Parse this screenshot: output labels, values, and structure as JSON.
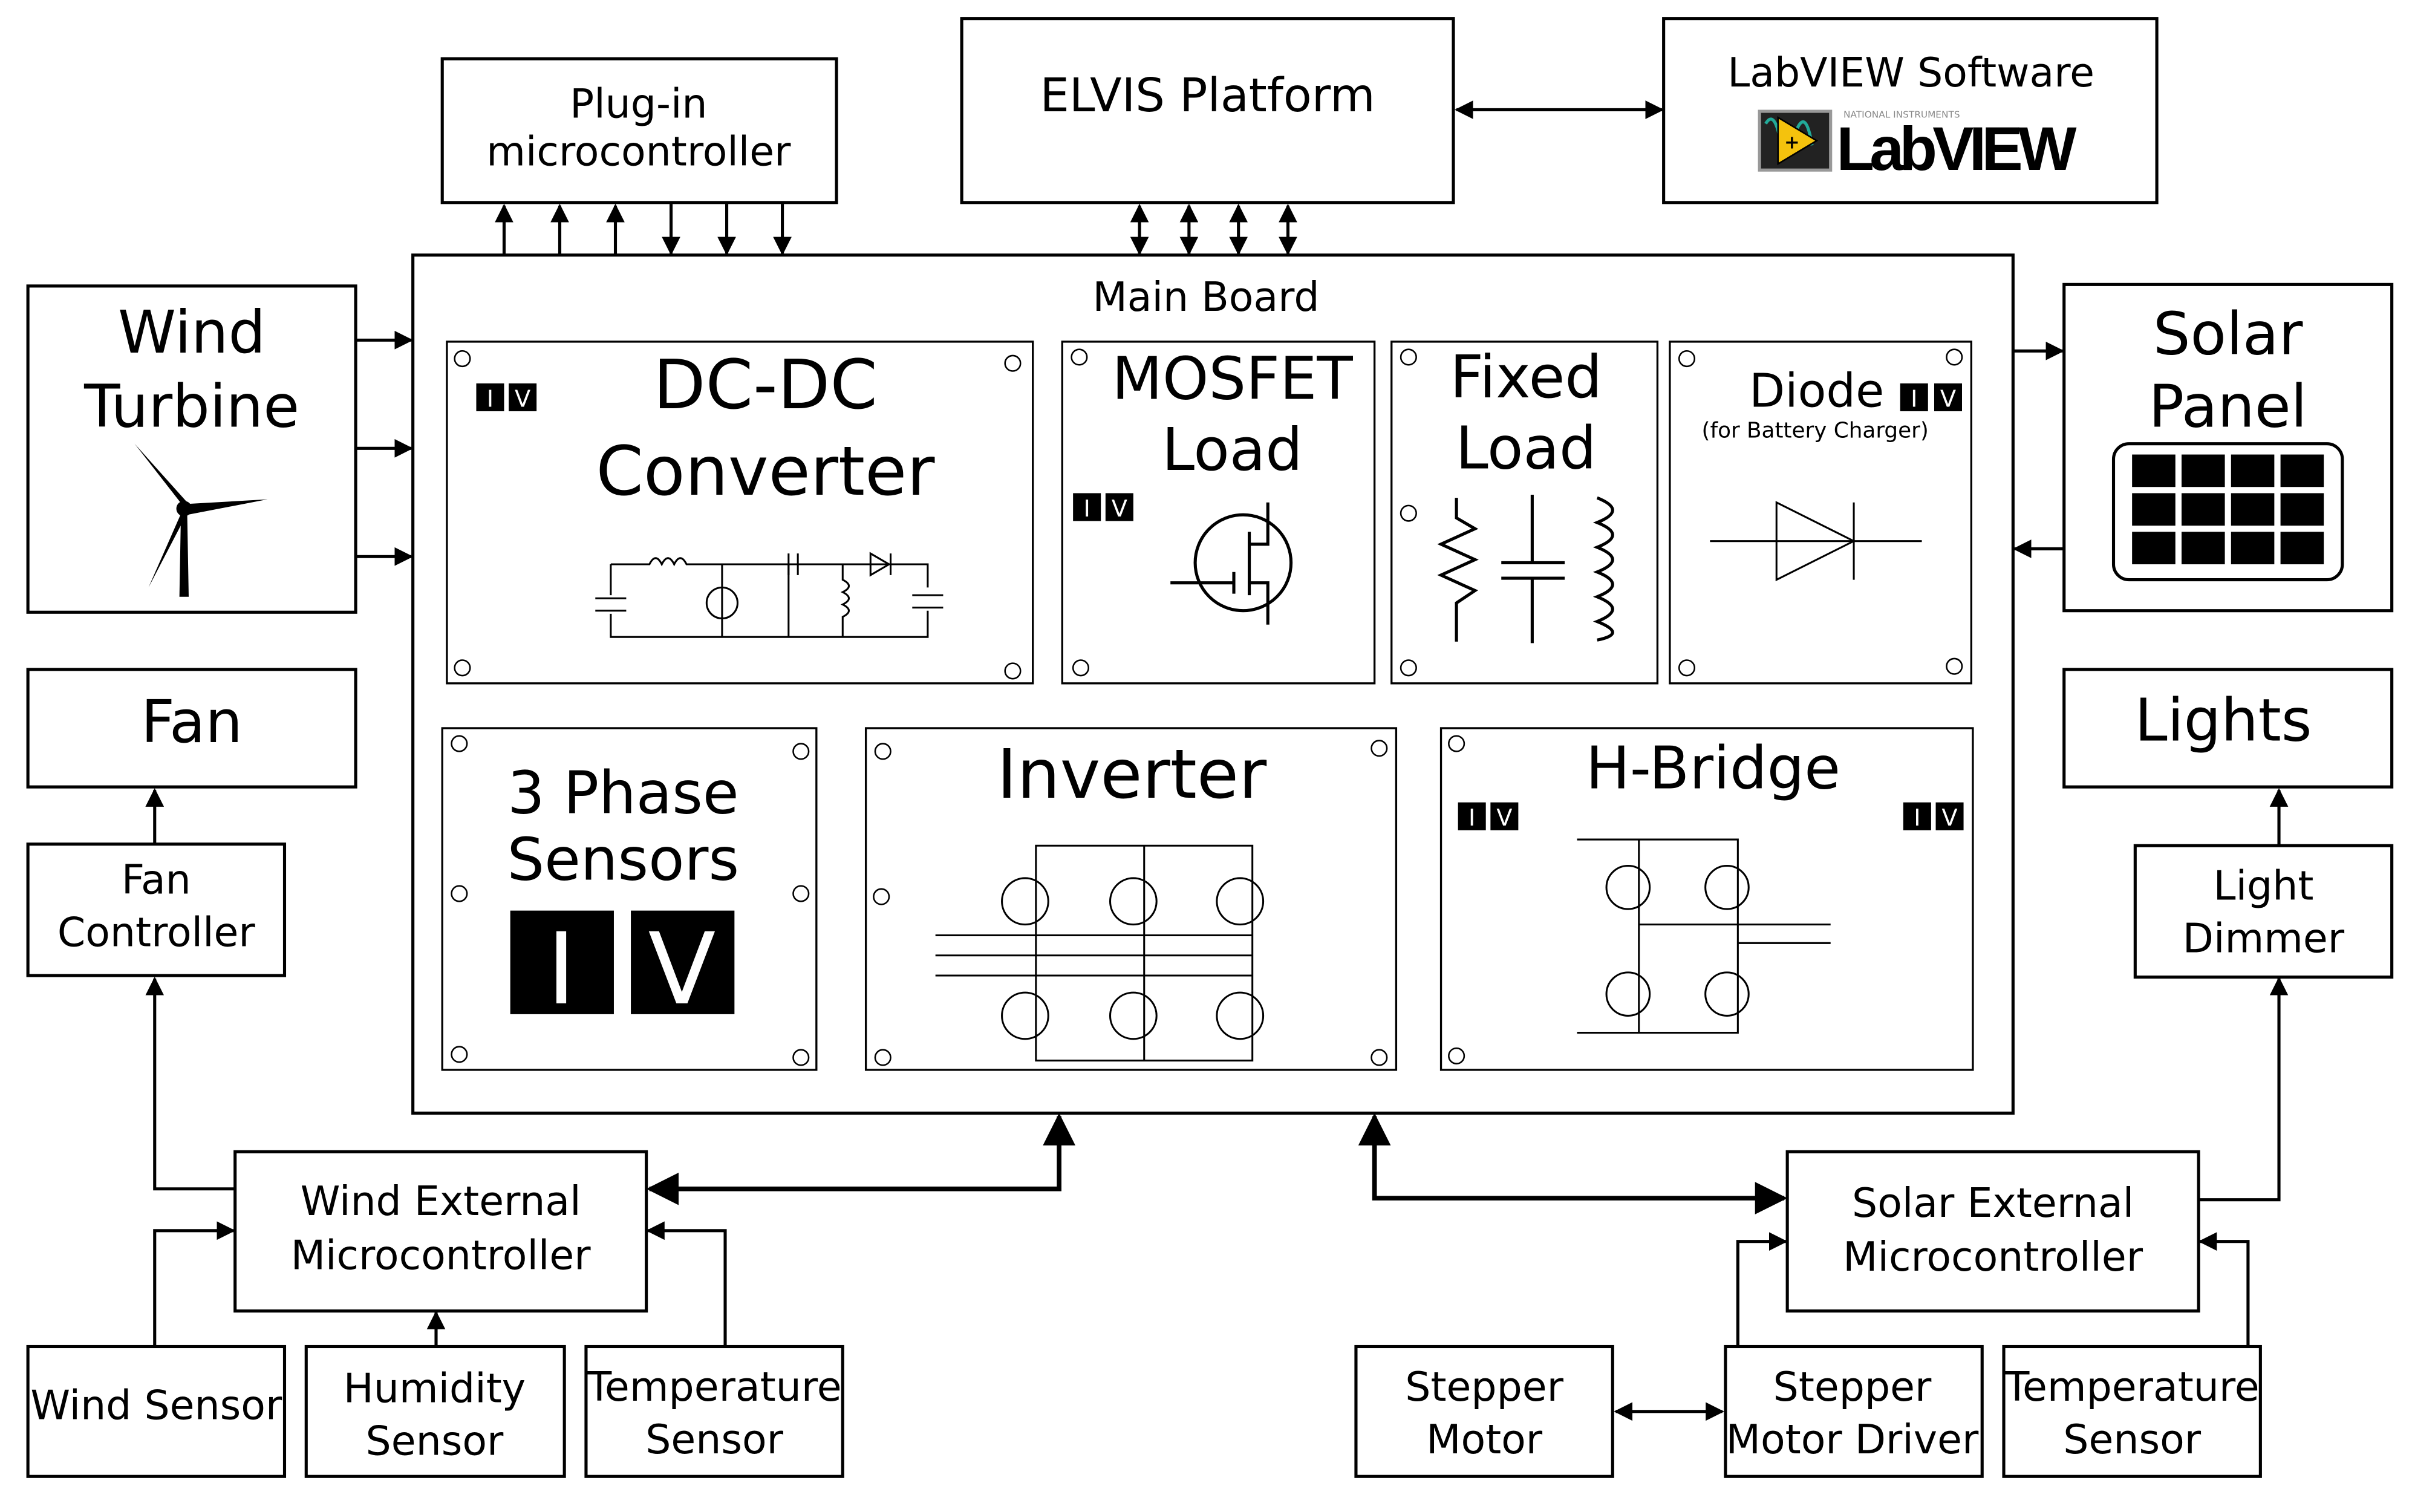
{
  "top": {
    "plugin": [
      "Plug-in",
      "microcontroller"
    ],
    "elvis": "ELVIS Platform",
    "labview": {
      "title": "LabVIEW Software",
      "logo_small": "NATIONAL INSTRUMENTS",
      "logo": "LabVIEW"
    }
  },
  "main_board": {
    "title": "Main Board",
    "modules": {
      "dcdc": [
        "DC-DC",
        "Converter"
      ],
      "mosfet": [
        "MOSFET",
        "Load"
      ],
      "fixed": [
        "Fixed",
        "Load"
      ],
      "diode": {
        "title": "Diode",
        "subtitle": "(for Battery Charger)"
      },
      "three_phase": [
        "3 Phase",
        "Sensors"
      ],
      "inverter": "Inverter",
      "hbridge": "H-Bridge"
    },
    "badge": {
      "i": "I",
      "v": "V"
    }
  },
  "left": {
    "wind_turbine": [
      "Wind",
      "Turbine"
    ],
    "fan": "Fan",
    "fan_controller": [
      "Fan",
      "Controller"
    ],
    "wind_mcu": [
      "Wind External",
      "Microcontroller"
    ],
    "wind_sensor": "Wind Sensor",
    "humidity": [
      "Humidity",
      "Sensor"
    ],
    "temperature": [
      "Temperature",
      "Sensor"
    ]
  },
  "right": {
    "solar_panel": [
      "Solar",
      "Panel"
    ],
    "lights": "Lights",
    "light_dimmer": [
      "Light",
      "Dimmer"
    ],
    "solar_mcu": [
      "Solar External",
      "Microcontroller"
    ],
    "stepper_motor": [
      "Stepper",
      "Motor"
    ],
    "stepper_driver": [
      "Stepper",
      "Motor Driver"
    ],
    "temperature": [
      "Temperature",
      "Sensor"
    ]
  }
}
